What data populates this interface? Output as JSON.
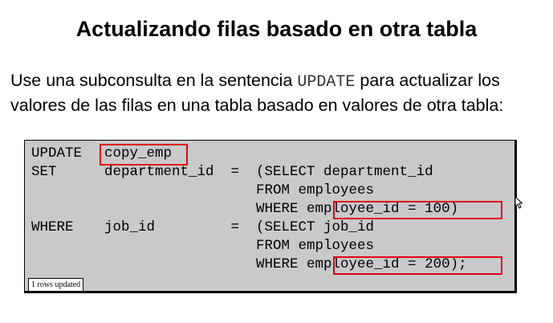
{
  "slide": {
    "title": "Actualizando filas basado en otra tabla",
    "intro": {
      "before": "Use una subconsulta en la sentencia ",
      "keyword": "UPDATE",
      "after": " para actualizar los valores de las filas en una tabla basado en valores de otra tabla:"
    }
  },
  "code": {
    "lines": [
      {
        "kw": "UPDATE",
        "body": "copy_emp"
      },
      {
        "kw": "SET",
        "body": "department_id  =  (SELECT department_id"
      },
      {
        "kw": "",
        "body": "                  FROM employees"
      },
      {
        "kw": "",
        "body": "                  WHERE employee_id = 100)"
      },
      {
        "kw": "WHERE",
        "body": "job_id         =  (SELECT job_id"
      },
      {
        "kw": "",
        "body": "                  FROM employees"
      },
      {
        "kw": "",
        "body": "                  WHERE employee_id = 200);"
      }
    ],
    "highlight_color": "#e2001a",
    "background_color": "#c9c9c9",
    "result_label": "1 rows updated"
  }
}
